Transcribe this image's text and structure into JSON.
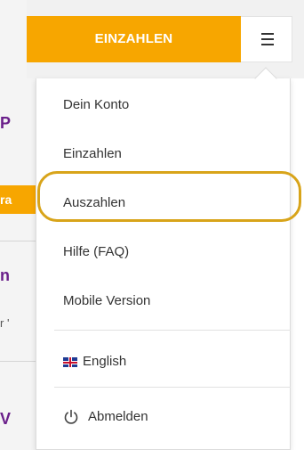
{
  "background": {
    "fragments": [
      "P",
      "ra",
      "n",
      "r '",
      "V"
    ]
  },
  "header": {
    "deposit_button": "EINZAHLEN",
    "menu_icon": "hamburger-icon"
  },
  "menu": {
    "items": [
      {
        "label": "Dein Konto"
      },
      {
        "label": "Einzahlen"
      },
      {
        "label": "Auszahlen"
      },
      {
        "label": "Hilfe (FAQ)"
      },
      {
        "label": "Mobile Version"
      }
    ],
    "language": {
      "label": "English",
      "icon": "uk-flag-icon"
    },
    "logout": {
      "label": "Abmelden",
      "icon": "power-icon"
    }
  },
  "colors": {
    "accent": "#f7a600",
    "highlight": "#d8a41a",
    "brand_text": "#6a1f8a"
  }
}
